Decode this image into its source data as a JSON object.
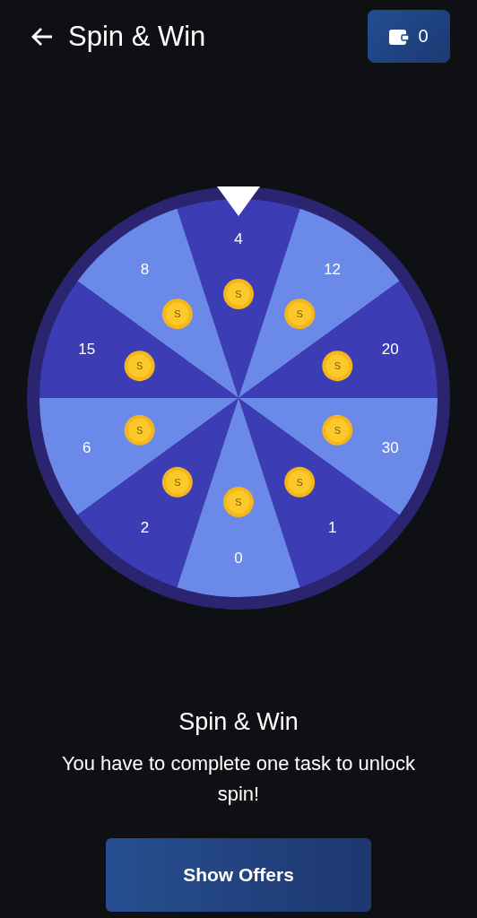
{
  "header": {
    "title": "Spin & Win",
    "wallet_balance": "0"
  },
  "wheel": {
    "segments": [
      {
        "label": "4",
        "coin": "S",
        "color": "#3c3db5"
      },
      {
        "label": "8",
        "coin": "S",
        "color": "#6b89e8"
      },
      {
        "label": "12",
        "coin": "S",
        "color": "#6b89e8"
      },
      {
        "label": "15",
        "coin": "S",
        "color": "#3c3db5"
      },
      {
        "label": "20",
        "coin": "S",
        "color": "#3c3db5"
      },
      {
        "label": "6",
        "coin": "S",
        "color": "#6b89e8"
      },
      {
        "label": "30",
        "coin": "S",
        "color": "#6b89e8"
      },
      {
        "label": "2",
        "coin": "S",
        "color": "#3c3db5"
      },
      {
        "label": "1",
        "coin": "S",
        "color": "#3c3db5"
      },
      {
        "label": "0",
        "coin": "S",
        "color": "#6b89e8"
      }
    ]
  },
  "info": {
    "title": "Spin & Win",
    "message": "You have to complete one task to unlock spin!"
  },
  "button": {
    "label": "Show Offers"
  }
}
